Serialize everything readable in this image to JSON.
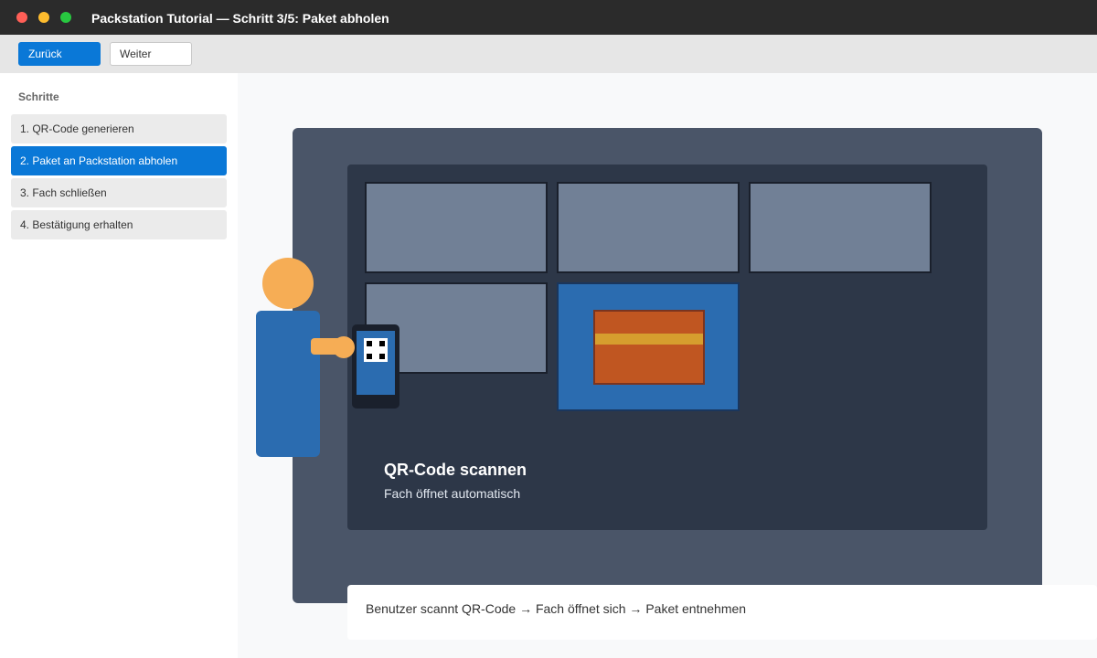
{
  "window": {
    "title": "Packstation Tutorial — Schritt 3/5: Paket abholen"
  },
  "toolbar": {
    "back_label": "Zurück",
    "next_label": "Weiter"
  },
  "sidebar": {
    "heading": "Schritte",
    "active_index": 1,
    "items": [
      {
        "label": "1. QR-Code generieren"
      },
      {
        "label": "2. Paket an Packstation abholen"
      },
      {
        "label": "3. Fach schließen"
      },
      {
        "label": "4. Bestätigung erhalten"
      }
    ]
  },
  "scene": {
    "title": "QR-Code scannen",
    "subtitle": "Fach öffnet automatisch",
    "caption": "Benutzer scannt QR-Code → Fach öffnet sich → Paket entnehmen"
  },
  "colors": {
    "accent": "#0a78d7",
    "titlebar": "#2b2b2b",
    "station": "#2d3748",
    "locker_closed": "#718096",
    "locker_open": "#2b6cb0",
    "parcel": "#c05621"
  }
}
